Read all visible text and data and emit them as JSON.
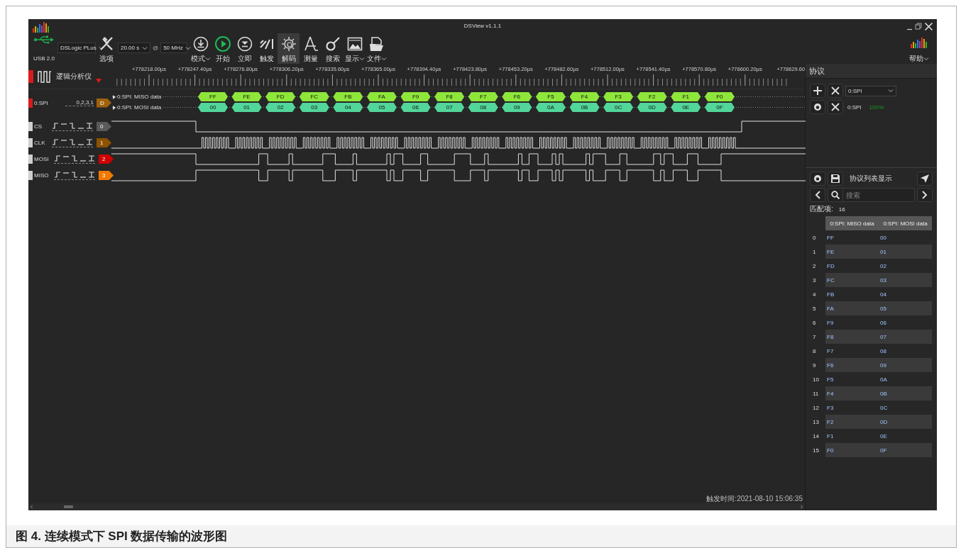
{
  "window": {
    "title": "DSView v1.1.1"
  },
  "toolbar": {
    "usb_label": "USB 2.0",
    "device": "DSLogic PLus",
    "options_label": "选项",
    "duration": "20.00 s",
    "at": "@",
    "samplerate": "50 MHz",
    "buttons": [
      {
        "kind": "mode",
        "label": "模式",
        "dropdown": true,
        "selected": false
      },
      {
        "kind": "start",
        "label": "开始",
        "dropdown": false,
        "selected": false
      },
      {
        "kind": "instant",
        "label": "立即",
        "dropdown": false,
        "selected": false
      },
      {
        "kind": "trigger",
        "label": "触发",
        "dropdown": false,
        "selected": false
      },
      {
        "kind": "decode",
        "label": "解码",
        "dropdown": false,
        "selected": true
      },
      {
        "kind": "measure",
        "label": "测量",
        "dropdown": false,
        "selected": false
      },
      {
        "kind": "search",
        "label": "搜索",
        "dropdown": false,
        "selected": false
      },
      {
        "kind": "display",
        "label": "显示",
        "dropdown": true,
        "selected": false
      },
      {
        "kind": "file",
        "label": "文件",
        "dropdown": true,
        "selected": false
      }
    ],
    "help": "帮助"
  },
  "ruler": {
    "title": "逻辑分析仪",
    "ticks": [
      "+778218.00µs",
      "+778247.40µs",
      "+778276.80µs",
      "+778306.20µs",
      "+778335.60µs",
      "+778365.00µs",
      "+778394.40µs",
      "+778423.80µs",
      "+778453.20µs",
      "+778482.60µs",
      "+778512.00µs",
      "+778541.40µs",
      "+778570.80µs",
      "+778600.20µs",
      "+778629.60"
    ]
  },
  "decoder": {
    "name": "0:SPI",
    "channels": "0,2,3,1",
    "badge": "D",
    "rows": [
      {
        "kind": "miso",
        "label": "0:SPI: MISO data",
        "values": [
          "FF",
          "FE",
          "FD",
          "FC",
          "FB",
          "FA",
          "F9",
          "F8",
          "F7",
          "F6",
          "F5",
          "F4",
          "F3",
          "F2",
          "F1",
          "F0"
        ]
      },
      {
        "kind": "mosi",
        "label": "0:SPI: MOSI data",
        "values": [
          "00",
          "01",
          "02",
          "03",
          "04",
          "05",
          "06",
          "07",
          "08",
          "09",
          "0A",
          "0B",
          "0C",
          "0D",
          "0E",
          "0F"
        ]
      }
    ]
  },
  "channels": [
    {
      "kind": "select",
      "name": "CS",
      "badge": "0",
      "color": "#5a5a5a"
    },
    {
      "kind": "clock",
      "name": "CLK",
      "badge": "1",
      "color": "#8c5200"
    },
    {
      "kind": "mosi",
      "name": "MOSI",
      "badge": "2",
      "color": "#d00000"
    },
    {
      "kind": "miso",
      "name": "MISO",
      "badge": "3",
      "color": "#f07800"
    }
  ],
  "status": {
    "trigger_time": "触发时间:2021-08-10 15:06:35"
  },
  "dock": {
    "title": "协议",
    "decoder_select": "0:SPI",
    "decoder_name": "0:SPI",
    "progress": "100%",
    "list_title": "协议列表显示",
    "search": {
      "placeholder": "搜索"
    },
    "matches_label": "匹配项:",
    "matches": "16",
    "table": {
      "columns": [
        "0:SPI: MISO data",
        "0:SPI: MOSI data"
      ],
      "rows": [
        {
          "index": "0",
          "cells": [
            "FF",
            "00"
          ]
        },
        {
          "index": "1",
          "cells": [
            "FE",
            "01"
          ]
        },
        {
          "index": "2",
          "cells": [
            "FD",
            "02"
          ]
        },
        {
          "index": "3",
          "cells": [
            "FC",
            "03"
          ]
        },
        {
          "index": "4",
          "cells": [
            "FB",
            "04"
          ]
        },
        {
          "index": "5",
          "cells": [
            "FA",
            "05"
          ]
        },
        {
          "index": "6",
          "cells": [
            "F9",
            "06"
          ]
        },
        {
          "index": "7",
          "cells": [
            "F8",
            "07"
          ]
        },
        {
          "index": "8",
          "cells": [
            "F7",
            "08"
          ]
        },
        {
          "index": "9",
          "cells": [
            "F6",
            "09"
          ]
        },
        {
          "index": "10",
          "cells": [
            "F5",
            "0A"
          ]
        },
        {
          "index": "11",
          "cells": [
            "F4",
            "0B"
          ]
        },
        {
          "index": "12",
          "cells": [
            "F3",
            "0C"
          ]
        },
        {
          "index": "13",
          "cells": [
            "F2",
            "0D"
          ]
        },
        {
          "index": "14",
          "cells": [
            "F1",
            "0E"
          ]
        },
        {
          "index": "15",
          "cells": [
            "F0",
            "0F"
          ]
        }
      ]
    }
  },
  "caption": "图 4. 连续模式下 SPI 数据传输的波形图"
}
